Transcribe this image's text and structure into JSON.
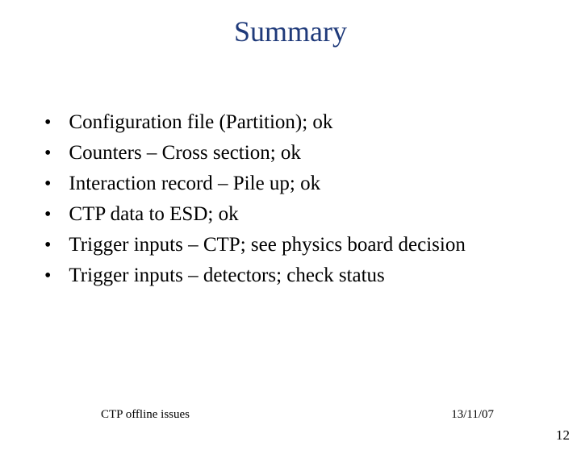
{
  "title": "Summary",
  "bullets": [
    "Configuration file (Partition); ok",
    "Counters – Cross section; ok",
    "Interaction record – Pile up; ok",
    "CTP data to ESD; ok",
    "Trigger inputs – CTP; see physics board decision",
    "Trigger inputs – detectors; check status"
  ],
  "footer": {
    "left": "CTP offline issues",
    "right": "13/11/07"
  },
  "page_number": "12"
}
